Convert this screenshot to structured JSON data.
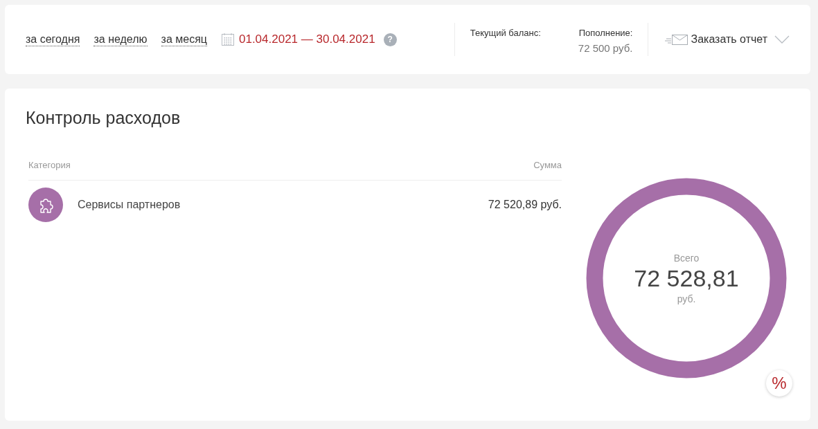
{
  "period_links": [
    {
      "label": "за сегодня"
    },
    {
      "label": "за неделю"
    },
    {
      "label": "за месяц"
    }
  ],
  "date_range": "01.04.2021 — 30.04.2021",
  "help": "?",
  "balance": {
    "label": "Текущий баланс:"
  },
  "topup": {
    "label": "Пополнение:",
    "value": "72 500 руб."
  },
  "report_button": "Заказать отчет",
  "title": "Контроль расходов",
  "columns": [
    "Категория",
    "Сумма"
  ],
  "rows": [
    {
      "category": "Сервисы партнеров",
      "amount": "72 520,89 руб.",
      "color": "#a66fa8"
    }
  ],
  "total": {
    "label": "Всего",
    "value": "72 528,81",
    "unit": "руб."
  },
  "percent_button": "%"
}
